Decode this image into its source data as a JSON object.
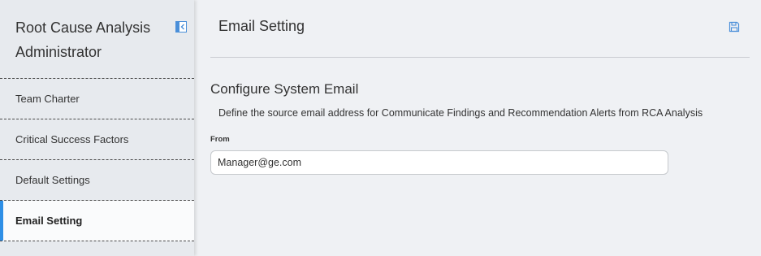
{
  "sidebar": {
    "title": "Root Cause Analysis Administrator",
    "collapse_icon": "chevron-left-icon",
    "items": [
      {
        "label": "Team Charter",
        "active": false
      },
      {
        "label": "Critical Success Factors",
        "active": false
      },
      {
        "label": "Default Settings",
        "active": false
      },
      {
        "label": "Email Setting",
        "active": true
      }
    ]
  },
  "main": {
    "title": "Email Setting",
    "save_icon": "save-icon",
    "section": {
      "title": "Configure System Email",
      "description": "Define the source email address for Communicate Findings and Recommendation Alerts from RCA Analysis"
    },
    "from_field": {
      "label": "From",
      "value": "Manager@ge.com"
    }
  },
  "colors": {
    "accent": "#2e8fe6",
    "sidebar_bg": "#e7eaee",
    "main_bg": "#eff1f4"
  }
}
